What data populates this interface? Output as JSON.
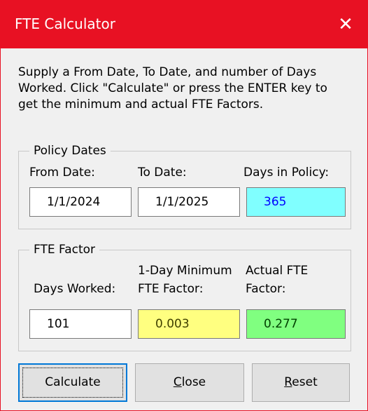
{
  "window": {
    "title": "FTE Calculator",
    "close_glyph": "✕",
    "accent_color": "#e81123"
  },
  "instructions": "Supply a From Date, To Date, and number of Days Worked. Click \"Calculate\" or press the ENTER key to get the minimum and actual FTE Factors.",
  "policy_dates": {
    "legend": "Policy Dates",
    "from_label": "From Date:",
    "from_value": "1/1/2024",
    "to_label": "To Date:",
    "to_value": "1/1/2025",
    "days_label": "Days in Policy:",
    "days_value": "365",
    "days_bg": "#80ffff"
  },
  "fte_factor": {
    "legend": "FTE Factor",
    "days_worked_label": "Days Worked:",
    "days_worked_value": "101",
    "min_label_line1": "1-Day Minimum",
    "min_label_line2": "FTE Factor:",
    "min_value": "0.003",
    "min_bg": "#ffff80",
    "actual_label_line1": "Actual FTE",
    "actual_label_line2": "Factor:",
    "actual_value": "0.277",
    "actual_bg": "#80ff80"
  },
  "buttons": {
    "calculate": "Calculate",
    "close_first": "C",
    "close_rest": "lose",
    "reset_first": "R",
    "reset_rest": "eset"
  }
}
